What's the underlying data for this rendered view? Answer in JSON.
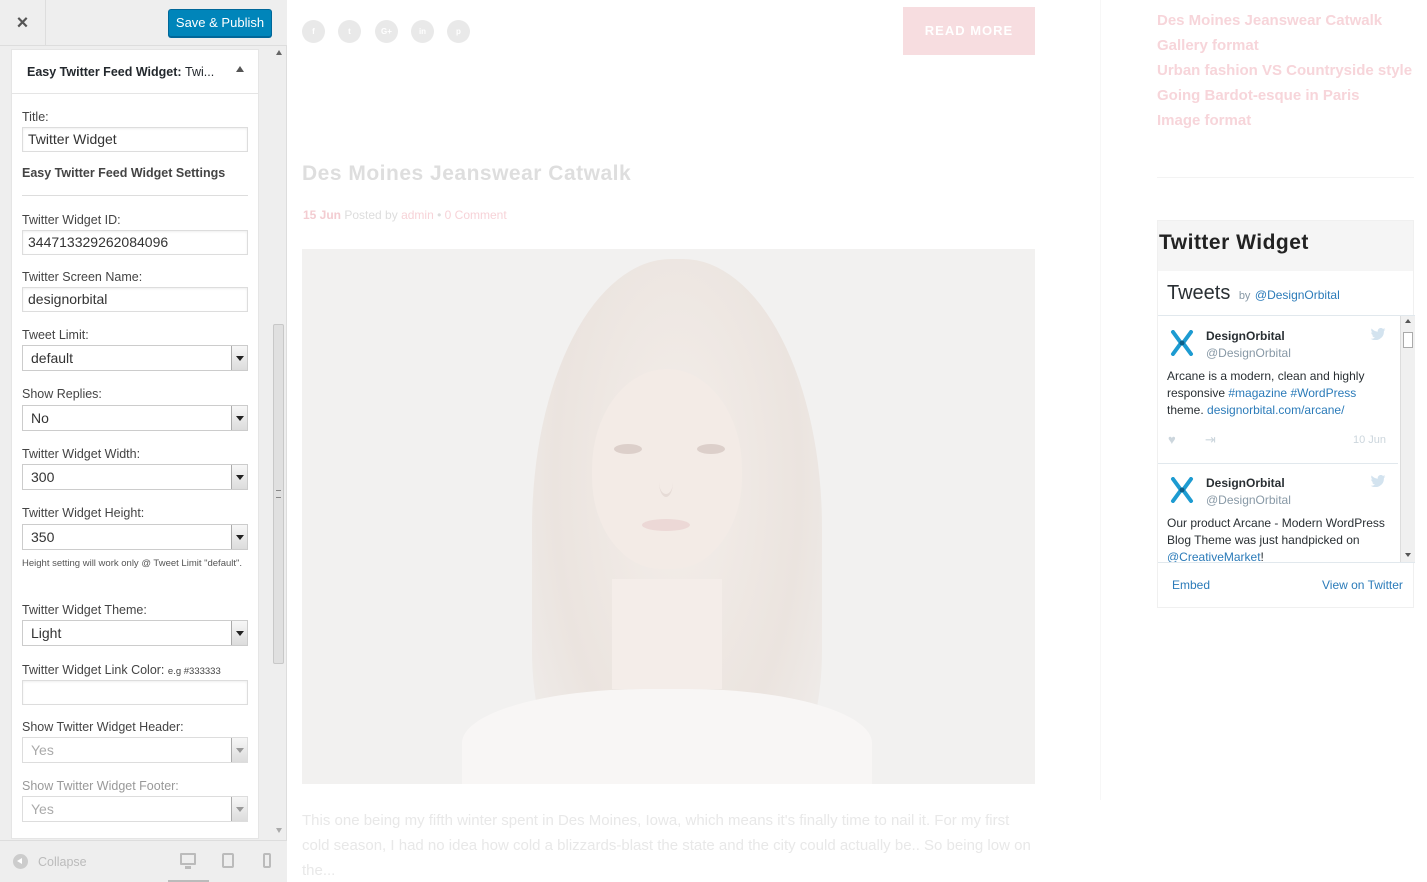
{
  "panel": {
    "close_label": "×",
    "publish_label": "Save & Publish",
    "widget_title": "Easy Twitter Feed Widget:",
    "widget_title_sub": "Twi...",
    "title_label": "Title:",
    "title_value": "Twitter Widget",
    "settings_heading": "Easy Twitter Feed Widget Settings",
    "widget_id_label": "Twitter Widget ID:",
    "widget_id_value": "344713329262084096",
    "screen_name_label": "Twitter Screen Name:",
    "screen_name_value": "designorbital",
    "tweet_limit_label": "Tweet Limit:",
    "tweet_limit_value": "default",
    "show_replies_label": "Show Replies:",
    "show_replies_value": "No",
    "width_label": "Twitter Widget Width:",
    "width_value": "300",
    "height_label": "Twitter Widget Height:",
    "height_value": "350",
    "height_note": "Height setting will work only @ Tweet Limit \"default\".",
    "theme_label": "Twitter Widget Theme:",
    "theme_value": "Light",
    "link_color_label": "Twitter Widget Link Color:",
    "link_color_hint": "e.g #333333",
    "link_color_value": "",
    "show_header_label": "Show Twitter Widget Header:",
    "show_header_value": "Yes",
    "show_footer_label": "Show Twitter Widget Footer:",
    "show_footer_value": "Yes",
    "collapse_label": "Collapse"
  },
  "preview": {
    "social_icons": [
      "f",
      "t",
      "G+",
      "in",
      "p"
    ],
    "read_more": "READ MORE",
    "post_title": "Des Moines Jeanswear Catwalk",
    "post_date": "15 Jun",
    "posted_by": "Posted by",
    "author": "admin",
    "bullet": "•",
    "comments": "0 Comment",
    "excerpt": "This one being my fifth winter spent in Des Moines, Iowa, which means it's finally time to nail it. For my first cold season, I had no idea how cold a blizzards-blast the state and the city could actually be.. So being low on the...",
    "recent_posts": [
      "Des Moines Jeanswear Catwalk",
      "Gallery format",
      "Urban fashion VS Countryside style",
      "Going Bardot-esque in Paris",
      "Image format"
    ]
  },
  "twitter": {
    "widget_title": "Twitter Widget",
    "tweets_heading": "Tweets",
    "by": "by",
    "handle": "@DesignOrbital",
    "tweets": [
      {
        "name": "DesignOrbital",
        "handle": "@DesignOrbital",
        "text_1": "Arcane is a modern, clean and highly responsive ",
        "hashtag_1": "#magazine",
        "space": " ",
        "hashtag_2": "#WordPress",
        "text_2": " theme. ",
        "link": "designorbital.com/arcane/",
        "date": "10 Jun"
      },
      {
        "name": "DesignOrbital",
        "handle": "@DesignOrbital",
        "text_1": "Our product Arcane - Modern WordPress Blog Theme was just handpicked on ",
        "link": "@CreativeMarket",
        "text_2": "!"
      }
    ],
    "embed": "Embed",
    "view_on_twitter": "View on Twitter"
  },
  "colors": {
    "publish_button": "#0085ba",
    "twitter_link": "#2b7bb9",
    "accent_pink": "#f7d5da"
  }
}
